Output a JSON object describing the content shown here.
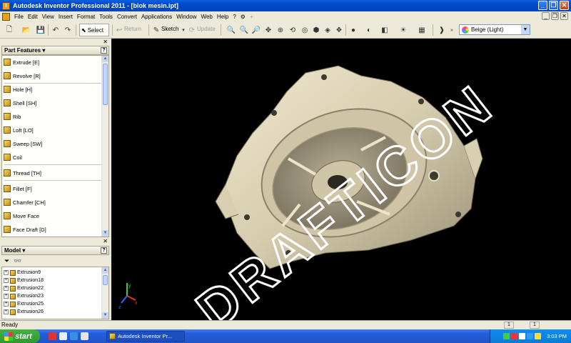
{
  "window": {
    "title": "Autodesk Inventor Professional 2011 - [blok mesin.ipt]"
  },
  "menu": [
    "File",
    "Edit",
    "View",
    "Insert",
    "Format",
    "Tools",
    "Convert",
    "Applications",
    "Window",
    "Web",
    "Help"
  ],
  "toolbar": {
    "select_label": "Select",
    "return_label": "Return",
    "sketch_label": "Sketch",
    "update_label": "Update",
    "appearance": "Beige (Light)"
  },
  "part_features": {
    "title": "Part Features",
    "items": [
      {
        "label": "Extrude   [E]"
      },
      {
        "label": "Revolve   [R]"
      },
      {
        "label": "Hole   [H]"
      },
      {
        "label": "Shell   [SH]"
      },
      {
        "label": "Rib"
      },
      {
        "label": "Loft   [LO]"
      },
      {
        "label": "Sweep   [SW]"
      },
      {
        "label": "Coil"
      },
      {
        "label": "Thread   [TH]"
      },
      {
        "label": "Fillet   [F]"
      },
      {
        "label": "Chamfer   [CH]"
      },
      {
        "label": "Move Face"
      },
      {
        "label": "Face Draft   [D]"
      }
    ]
  },
  "model": {
    "title": "Model",
    "tree": [
      "Extrusion9",
      "Extrusion18",
      "Extrusion22",
      "Extrusion23",
      "Extrusion25",
      "Extrusion26"
    ]
  },
  "viewport": {
    "watermark": "DRAFTICON",
    "triad": {
      "x": "x",
      "y": "y",
      "z": "z"
    }
  },
  "status": {
    "text": "Ready",
    "count1": "1",
    "count2": "1"
  },
  "taskbar": {
    "start": "start",
    "item": "Autodesk Inventor Pr...",
    "clock": "3:03 PM"
  }
}
